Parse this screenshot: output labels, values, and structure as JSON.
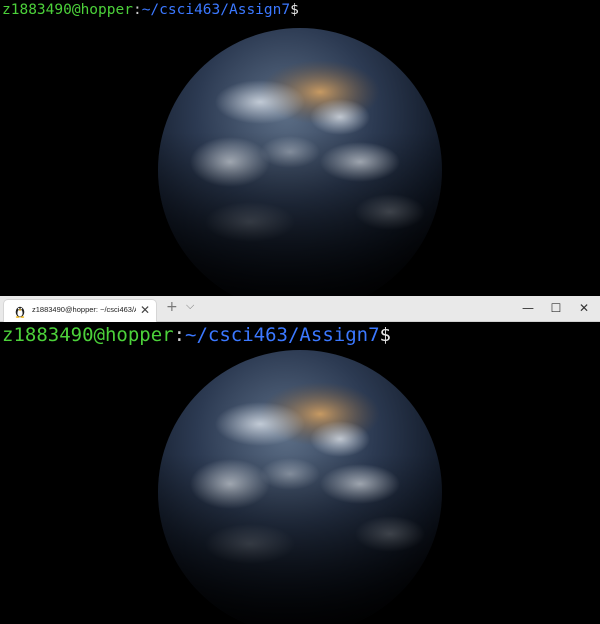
{
  "terminal": {
    "prompt": {
      "user_host": "z1883490@hopper",
      "colon": ":",
      "path": "~/csci463/Assign7",
      "symbol": "$"
    }
  },
  "tab": {
    "title": "z1883490@hopper: ~/csci463/A",
    "icon": "linux-tux-icon",
    "close": "✕"
  },
  "titlebar": {
    "new_tab": "+",
    "dropdown": "⌵",
    "minimize": "—",
    "maximize": "☐",
    "close": "✕"
  },
  "colors": {
    "user_host": "#4cd13a",
    "path": "#3b78ff",
    "background": "#000000",
    "titlebar": "#e9e9e9"
  }
}
